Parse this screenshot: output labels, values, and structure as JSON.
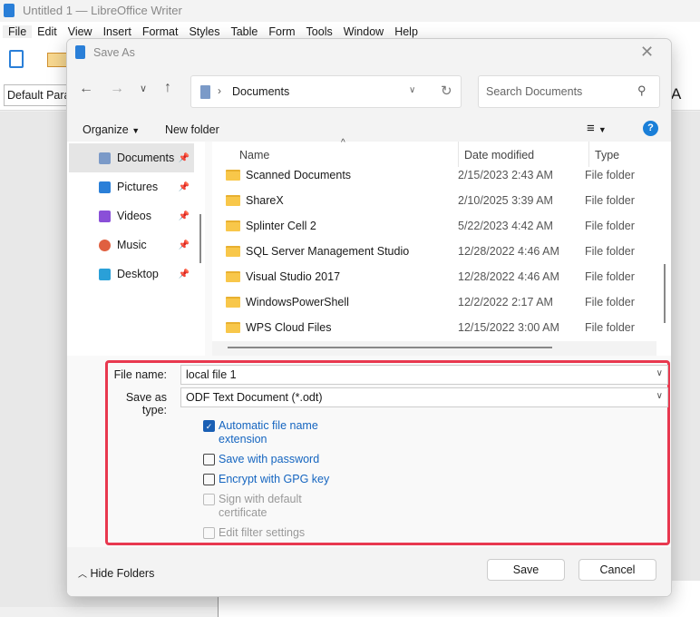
{
  "app": {
    "title": "Untitled 1 — LibreOffice Writer",
    "menu": [
      "File",
      "Edit",
      "View",
      "Insert",
      "Format",
      "Styles",
      "Table",
      "Form",
      "Tools",
      "Window",
      "Help"
    ],
    "style_box": "Default Parag"
  },
  "dialog": {
    "title": "Save As",
    "breadcrumb": "Documents",
    "search_placeholder": "Search Documents",
    "organize": "Organize",
    "new_folder": "New folder",
    "sidebar": [
      {
        "label": "Documents",
        "icon": "documents-icon",
        "color": "#7b9ac8"
      },
      {
        "label": "Pictures",
        "icon": "pictures-icon",
        "color": "#2a7fd8"
      },
      {
        "label": "Videos",
        "icon": "videos-icon",
        "color": "#8a4fd8"
      },
      {
        "label": "Music",
        "icon": "music-icon",
        "color": "#e06040"
      },
      {
        "label": "Desktop",
        "icon": "desktop-icon",
        "color": "#2aa0d8"
      }
    ],
    "columns": {
      "name": "Name",
      "date": "Date modified",
      "type": "Type"
    },
    "files": [
      {
        "name": "Scanned Documents",
        "date": "2/15/2023 2:43 AM",
        "type": "File folder"
      },
      {
        "name": "ShareX",
        "date": "2/10/2025 3:39 AM",
        "type": "File folder"
      },
      {
        "name": "Splinter Cell 2",
        "date": "5/22/2023 4:42 AM",
        "type": "File folder"
      },
      {
        "name": "SQL Server Management Studio",
        "date": "12/28/2022 4:46 AM",
        "type": "File folder"
      },
      {
        "name": "Visual Studio 2017",
        "date": "12/28/2022 4:46 AM",
        "type": "File folder"
      },
      {
        "name": "WindowsPowerShell",
        "date": "12/2/2022 2:17 AM",
        "type": "File folder"
      },
      {
        "name": "WPS Cloud Files",
        "date": "12/15/2022 3:00 AM",
        "type": "File folder"
      }
    ],
    "file_name_label": "File name:",
    "file_name": "local file 1",
    "type_label": "Save as type:",
    "type_value": "ODF Text Document (*.odt)",
    "options": [
      {
        "label": "Automatic file name",
        "label2": "extension",
        "checked": true,
        "enabled": true
      },
      {
        "label": "Save with password",
        "checked": false,
        "enabled": true
      },
      {
        "label": "Encrypt with GPG key",
        "checked": false,
        "enabled": true
      },
      {
        "label": "Sign with default",
        "label2": "certificate",
        "checked": false,
        "enabled": false
      },
      {
        "label": "Edit filter settings",
        "checked": false,
        "enabled": false
      }
    ],
    "hide_folders": "Hide Folders",
    "save": "Save",
    "cancel": "Cancel",
    "highlight_color": "#e8384f"
  }
}
